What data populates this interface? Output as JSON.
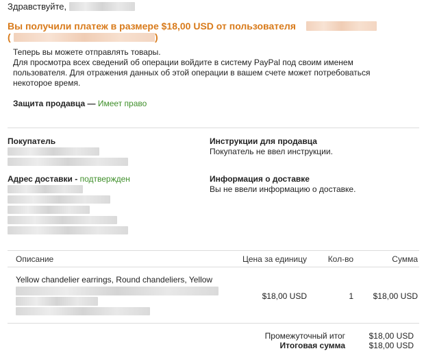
{
  "greeting": "Здравствуйте,",
  "headline": "Вы получили платеж в размере $18,00 USD от пользователя",
  "paren_open": "(",
  "paren_close": ")",
  "intro": {
    "line1": "Теперь вы можете отправлять товары.",
    "line2": "Для просмотра всех сведений об операции войдите в систему PayPal под своим именем",
    "line3": "пользователя. Для отражения данных об этой операции в вашем счете может потребоваться",
    "line4": "некоторое время."
  },
  "seller_protection": {
    "label": "Защита продавца —",
    "status": "Имеет право"
  },
  "buyer": {
    "label": "Покупатель"
  },
  "shipping_address": {
    "label": "Адрес доставки -",
    "status": "подтвержден"
  },
  "seller_instructions": {
    "label": "Инструкции для продавца",
    "value": "Покупатель не ввел инструкции."
  },
  "delivery_info": {
    "label": "Информация о доставке",
    "value": "Вы не ввели информацию о доставке."
  },
  "table": {
    "headers": {
      "description": "Описание",
      "unit_price": "Цена за единицу",
      "qty": "Кол-во",
      "amount": "Сумма"
    },
    "rows": [
      {
        "description": "Yellow chandelier earrings, Round chandeliers, Yellow",
        "unit_price": "$18,00 USD",
        "qty": "1",
        "amount": "$18,00 USD"
      }
    ]
  },
  "totals": {
    "subtotal_label": "Промежуточный итог",
    "subtotal_value": "$18,00 USD",
    "total_label": "Итоговая сумма",
    "total_value": "$18,00 USD"
  },
  "colors": {
    "headline": "#d87a1a",
    "green_status": "#3f8f2a",
    "divider": "#dcdcdc"
  }
}
